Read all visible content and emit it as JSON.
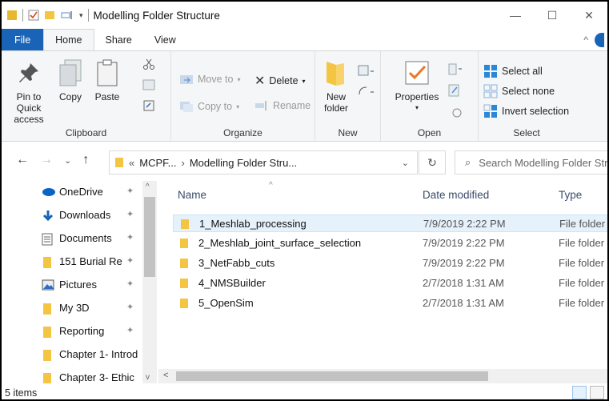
{
  "window": {
    "title": "Modelling Folder Structure",
    "minimize": "—",
    "maximize": "☐",
    "close": "✕"
  },
  "ribbon_tabs": [
    "File",
    "Home",
    "Share",
    "View"
  ],
  "ribbon": {
    "clipboard": {
      "label": "Clipboard",
      "pin_line1": "Pin to Quick",
      "pin_line2": "access",
      "copy": "Copy",
      "paste": "Paste"
    },
    "organize": {
      "label": "Organize",
      "move_to": "Move to",
      "copy_to": "Copy to",
      "delete": "Delete",
      "rename": "Rename"
    },
    "new": {
      "label": "New",
      "new_folder_line1": "New",
      "new_folder_line2": "folder"
    },
    "open": {
      "label": "Open",
      "properties": "Properties"
    },
    "select": {
      "label": "Select",
      "select_all": "Select all",
      "select_none": "Select none",
      "invert_selection": "Invert selection"
    }
  },
  "address": {
    "prefix": "«",
    "crumb1": "MCPF...",
    "separator": "›",
    "crumb2": "Modelling Folder Stru...",
    "search_placeholder": "Search Modelling Folder Stru..."
  },
  "nav_pane": [
    {
      "label": "OneDrive",
      "icon": "cloud-icon",
      "pinned": true
    },
    {
      "label": "Downloads",
      "icon": "download-icon",
      "pinned": true
    },
    {
      "label": "Documents",
      "icon": "document-icon",
      "pinned": true
    },
    {
      "label": "151 Burial Re",
      "icon": "folder-icon",
      "pinned": true
    },
    {
      "label": "Pictures",
      "icon": "pictures-icon",
      "pinned": true
    },
    {
      "label": "My 3D",
      "icon": "folder-icon",
      "pinned": true
    },
    {
      "label": "Reporting",
      "icon": "folder-icon",
      "pinned": true
    },
    {
      "label": "Chapter 1- Introd",
      "icon": "folder-icon",
      "pinned": false
    },
    {
      "label": "Chapter 3- Ethic",
      "icon": "folder-icon",
      "pinned": false
    }
  ],
  "columns": {
    "name": "Name",
    "date_modified": "Date modified",
    "type": "Type"
  },
  "files": [
    {
      "name": "1_Meshlab_processing",
      "date": "7/9/2019 2:22 PM",
      "type": "File folder",
      "selected": true
    },
    {
      "name": "2_Meshlab_joint_surface_selection",
      "date": "7/9/2019 2:22 PM",
      "type": "File folder",
      "selected": false
    },
    {
      "name": "3_NetFabb_cuts",
      "date": "7/9/2019 2:22 PM",
      "type": "File folder",
      "selected": false
    },
    {
      "name": "4_NMSBuilder",
      "date": "2/7/2018 1:31 AM",
      "type": "File folder",
      "selected": false
    },
    {
      "name": "5_OpenSim",
      "date": "2/7/2018 1:31 AM",
      "type": "File folder",
      "selected": false
    }
  ],
  "status": {
    "item_count": "5 items"
  },
  "colors": {
    "accent": "#1a64b8",
    "folder": "#f4c542",
    "selection": "#e5f1fb"
  }
}
